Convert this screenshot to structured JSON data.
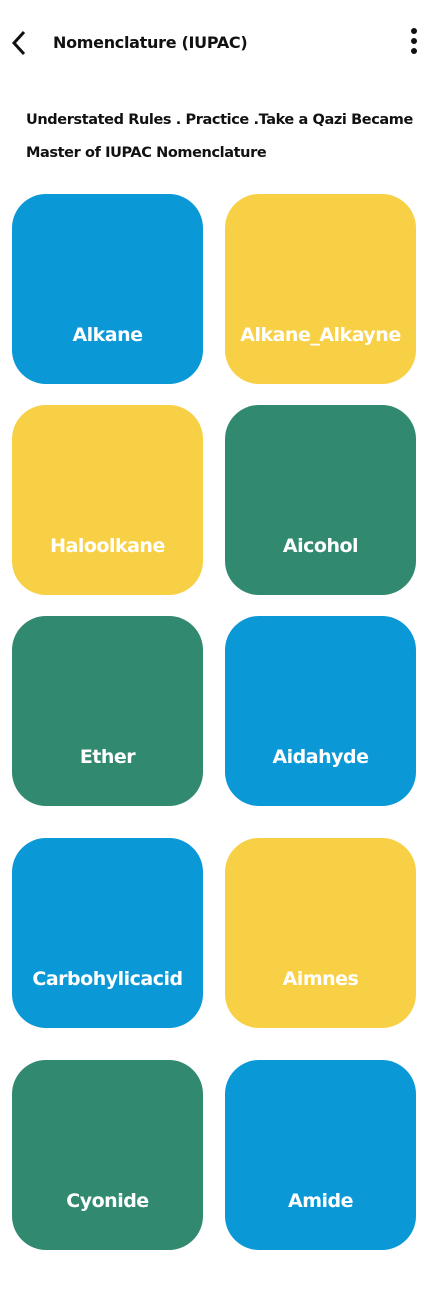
{
  "header": {
    "title": "Nomenclature (IUPAC)",
    "back_icon": "chevron-left-icon",
    "menu_icon": "more-vertical-icon"
  },
  "description": "Understated Rules . Practice .Take a Qazi Became Master of IUPAC Nomenclature",
  "colors": {
    "blue": "#0A98D6",
    "yellow": "#F8D046",
    "green": "#318970"
  },
  "tiles": [
    {
      "label": "Alkane",
      "color": "#0A98D6"
    },
    {
      "label": "Alkane_Alkayne",
      "color": "#F8D046"
    },
    {
      "label": "Haloolkane",
      "color": "#F8D046"
    },
    {
      "label": "Aicohol",
      "color": "#318970"
    },
    {
      "label": "Ether",
      "color": "#318970"
    },
    {
      "label": "Aidahyde",
      "color": "#0A98D6"
    },
    {
      "label": "Carbohylicacid",
      "color": "#0A98D6"
    },
    {
      "label": "Aimnes",
      "color": "#F8D046"
    },
    {
      "label": "Cyonide",
      "color": "#318970"
    },
    {
      "label": "Amide",
      "color": "#0A98D6"
    }
  ]
}
